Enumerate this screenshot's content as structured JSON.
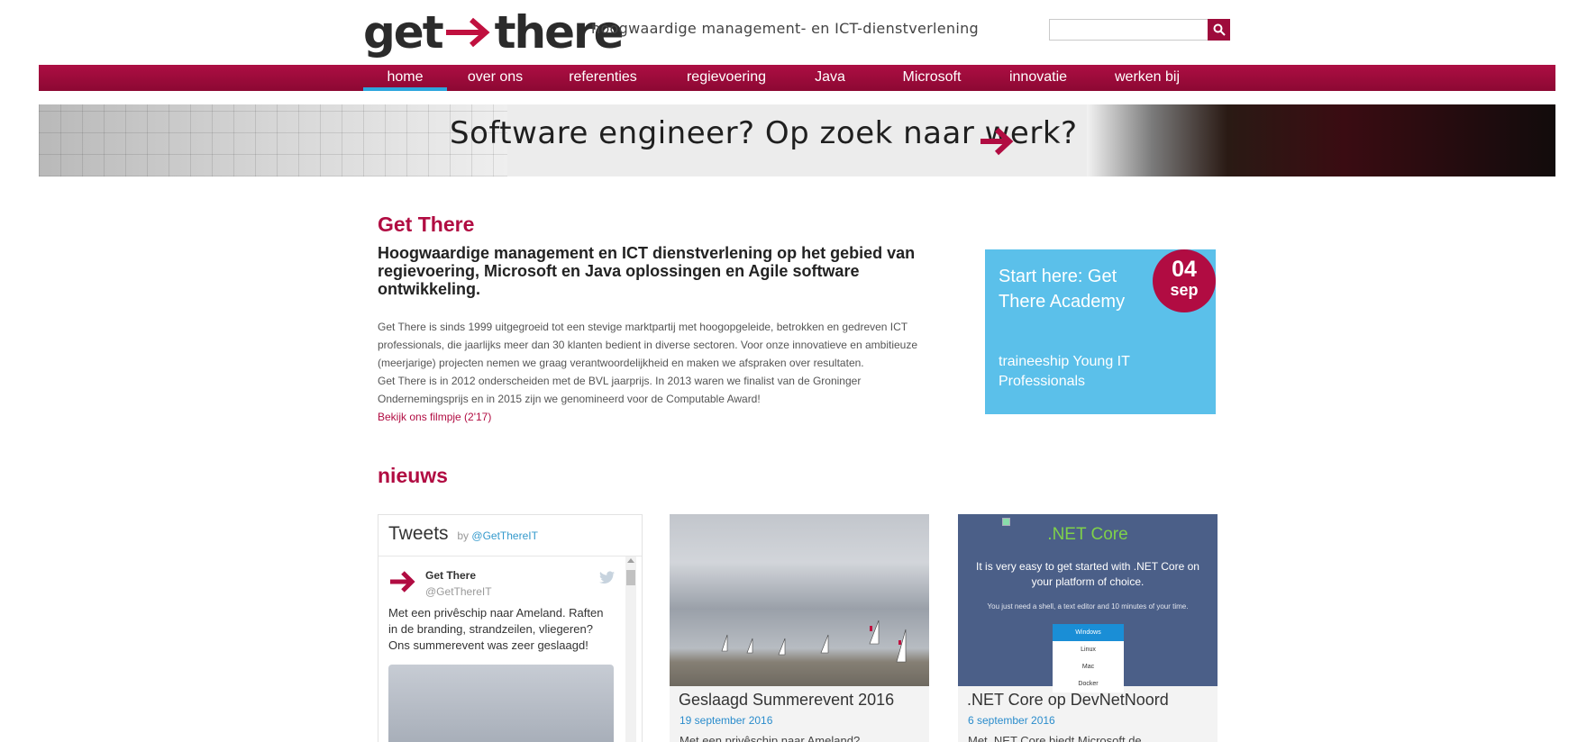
{
  "header": {
    "logo_left": "get",
    "logo_right": "there",
    "tagline": "hoogwaardige management- en ICT-dienstverlening",
    "search_placeholder": ""
  },
  "nav": {
    "items": [
      {
        "label": "home",
        "active": true
      },
      {
        "label": "over ons"
      },
      {
        "label": "referenties"
      },
      {
        "label": "regievoering"
      },
      {
        "label": "Java"
      },
      {
        "label": "Microsoft"
      },
      {
        "label": "innovatie"
      },
      {
        "label": "werken bij"
      }
    ]
  },
  "banner": {
    "text": "Software engineer? Op zoek naar werk?"
  },
  "main": {
    "title": "Get There",
    "subtitle": "Hoogwaardige management en ICT dienstverlening op het gebied van regievoering, Microsoft en Java oplossingen en Agile software ontwikkeling.",
    "body_1": "Get There is sinds 1999 uitgegroeid tot een stevige marktpartij met hoogopgeleide, betrokken en gedreven ICT professionals, die jaarlijks meer dan 30 klanten bedient in diverse sectoren. Voor onze innovatieve en ambitieuze (meerjarige) projecten nemen we graag verantwoordelijkheid en maken we afspraken over resultaten.",
    "body_2": "Get There is in 2012 onderscheiden met de BVL jaarprijs. In 2013 waren we finalist van de Groninger Ondernemingsprijs en in 2015 zijn we genomineerd voor de Computable Award!",
    "video_link": "Bekijk ons filmpje (2'17)"
  },
  "promo": {
    "title": "Start here: Get There Academy",
    "subtitle": "traineeship Young IT Professionals",
    "day": "04",
    "month": "sep"
  },
  "news": {
    "heading": "nieuws",
    "tweets": {
      "title": "Tweets",
      "by_prefix": "by",
      "by_handle": "@GetThereIT",
      "author_name": "Get There",
      "author_handle": "@GetThereIT",
      "text": "Met een privêschip naar Ameland. Raften in de branding, strandzeilen, vliegeren? Ons summerevent was zeer geslaagd!"
    },
    "cards": [
      {
        "title": "Geslaagd Summerevent 2016",
        "date": "19 september 2016",
        "excerpt": "Met een privêschip naar Ameland?"
      },
      {
        "title": ".NET Core op DevNetNoord",
        "date": "6 september 2016",
        "excerpt": "Met .NET Core biedt Microsoft de",
        "image": {
          "heading": ".NET Core",
          "line1": "It is very easy to get started with .NET Core on your platform of choice.",
          "line2": "You just need a shell, a text editor and 10 minutes of your time.",
          "menu": [
            "Windows",
            "Linux",
            "Mac",
            "Docker"
          ]
        }
      }
    ]
  },
  "colors": {
    "brand_red": "#b10c42",
    "nav_active": "#2da6dd",
    "promo_blue": "#5bc0ea",
    "link_blue": "#2a8ccc"
  }
}
